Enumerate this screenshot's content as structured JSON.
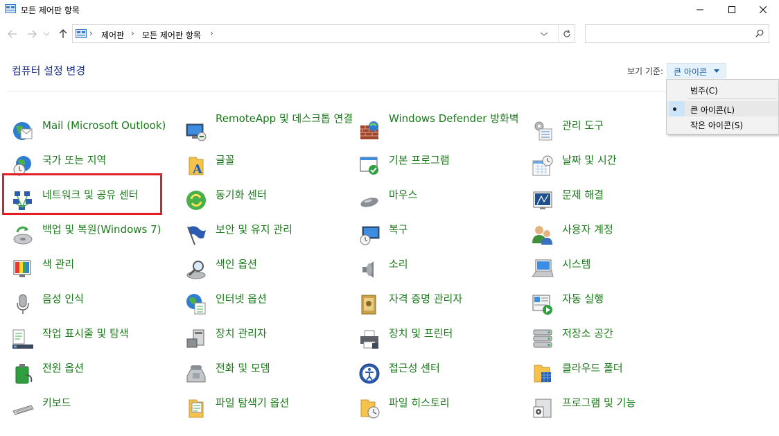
{
  "window": {
    "title": "모든 제어판 항목"
  },
  "address": {
    "crumbs": [
      "제어판",
      "모든 제어판 항목"
    ],
    "search_placeholder": ""
  },
  "header": {
    "title": "컴퓨터 설정 변경",
    "view_by_label": "보기 기준:",
    "view_by_value": "큰 아이콘"
  },
  "view_menu": {
    "items": [
      "범주(C)",
      "큰 아이콘(L)",
      "작은 아이콘(S)"
    ],
    "selected": "큰 아이콘(L)"
  },
  "items": [
    {
      "label": "Mail (Microsoft Outlook)",
      "icon": "mail-icon"
    },
    {
      "label": "RemoteApp 및 데스크톱 연결",
      "icon": "remoteapp-icon"
    },
    {
      "label": "Windows Defender 방화벽",
      "icon": "firewall-icon"
    },
    {
      "label": "관리 도구",
      "icon": "admin-tools-icon"
    },
    {
      "label": "국가 또는 지역",
      "icon": "region-icon"
    },
    {
      "label": "글꼴",
      "icon": "fonts-icon"
    },
    {
      "label": "기본 프로그램",
      "icon": "default-programs-icon"
    },
    {
      "label": "날짜 및 시간",
      "icon": "date-time-icon"
    },
    {
      "label": "네트워크 및 공유 센터",
      "icon": "network-icon"
    },
    {
      "label": "동기화 센터",
      "icon": "sync-icon"
    },
    {
      "label": "마우스",
      "icon": "mouse-icon"
    },
    {
      "label": "문제 해결",
      "icon": "troubleshoot-icon"
    },
    {
      "label": "백업 및 복원(Windows 7)",
      "icon": "backup-icon"
    },
    {
      "label": "보안 및 유지 관리",
      "icon": "security-flag-icon"
    },
    {
      "label": "복구",
      "icon": "recovery-icon"
    },
    {
      "label": "사용자 계정",
      "icon": "user-accounts-icon"
    },
    {
      "label": "색 관리",
      "icon": "color-management-icon"
    },
    {
      "label": "색인 옵션",
      "icon": "indexing-icon"
    },
    {
      "label": "소리",
      "icon": "sound-icon"
    },
    {
      "label": "시스템",
      "icon": "system-icon"
    },
    {
      "label": "음성 인식",
      "icon": "microphone-icon"
    },
    {
      "label": "인터넷 옵션",
      "icon": "internet-options-icon"
    },
    {
      "label": "자격 증명 관리자",
      "icon": "credential-icon"
    },
    {
      "label": "자동 실행",
      "icon": "autoplay-icon"
    },
    {
      "label": "작업 표시줄 및 탐색",
      "icon": "taskbar-icon"
    },
    {
      "label": "장치 관리자",
      "icon": "device-manager-icon"
    },
    {
      "label": "장치 및 프린터",
      "icon": "printer-icon"
    },
    {
      "label": "저장소 공간",
      "icon": "storage-spaces-icon"
    },
    {
      "label": "전원 옵션",
      "icon": "power-icon"
    },
    {
      "label": "전화 및 모뎀",
      "icon": "phone-modem-icon"
    },
    {
      "label": "접근성 센터",
      "icon": "ease-of-access-icon"
    },
    {
      "label": "클라우드 폴더",
      "icon": "work-folders-icon"
    },
    {
      "label": "키보드",
      "icon": "keyboard-icon"
    },
    {
      "label": "파일 탐색기 옵션",
      "icon": "folder-options-icon"
    },
    {
      "label": "파일 히스토리",
      "icon": "file-history-icon"
    },
    {
      "label": "프로그램 및 기능",
      "icon": "programs-icon"
    }
  ]
}
